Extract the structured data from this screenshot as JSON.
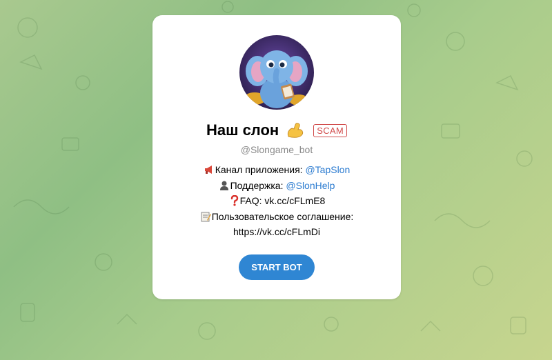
{
  "bot": {
    "name": "Наш слон",
    "badge": "SCAM",
    "username": "@Slongame_bot",
    "avatar_icon": "elephant-avatar-icon"
  },
  "description": {
    "line1_label": "Канал приложения: ",
    "line1_link": "@TapSlon",
    "line1_icon": "megaphone-icon",
    "line2_label": "Поддержка: ",
    "line2_link": "@SlonHelp",
    "line2_icon": "person-icon",
    "line3_label": "FAQ: vk.cc/cFLmE8",
    "line3_icon": "question-icon",
    "line4_label": "Пользовательское соглашение:",
    "line4_icon": "memo-icon",
    "line5_text": "https://vk.cc/cFLmDi"
  },
  "actions": {
    "start_label": "START BOT"
  },
  "colors": {
    "accent": "#2f86d3",
    "link": "#2b7bd0",
    "scam": "#d14b4b",
    "muted": "#8a8a8a"
  }
}
